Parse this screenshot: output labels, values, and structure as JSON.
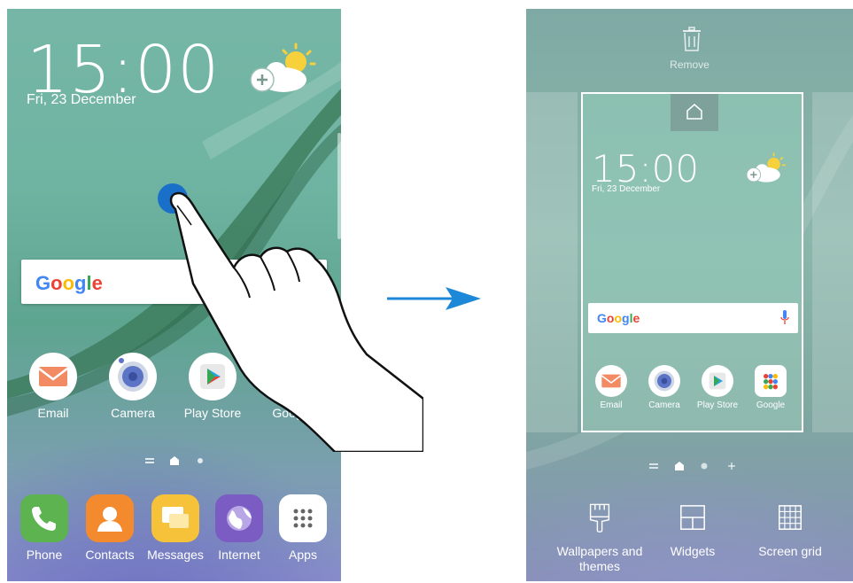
{
  "left_screen": {
    "clock": "15:00",
    "date": "Fri, 23 December",
    "search_logo": "Google",
    "apps": [
      {
        "label": "Email",
        "icon": "email-icon"
      },
      {
        "label": "Camera",
        "icon": "camera-icon"
      },
      {
        "label": "Play Store",
        "icon": "play-store-icon"
      },
      {
        "label": "Google",
        "icon": "google-apps-icon"
      }
    ],
    "dock": [
      {
        "label": "Phone",
        "icon": "phone-icon"
      },
      {
        "label": "Contacts",
        "icon": "contacts-icon"
      },
      {
        "label": "Messages",
        "icon": "messages-icon"
      },
      {
        "label": "Internet",
        "icon": "internet-icon"
      },
      {
        "label": "Apps",
        "icon": "apps-grid-icon"
      }
    ]
  },
  "right_screen": {
    "remove_label": "Remove",
    "preview": {
      "clock": "15:00",
      "date": "Fri, 23 December",
      "search_logo": "Google",
      "apps": [
        {
          "label": "Email"
        },
        {
          "label": "Camera"
        },
        {
          "label": "Play Store"
        },
        {
          "label": "Google"
        }
      ]
    },
    "options": [
      {
        "label_line1": "Wallpapers and",
        "label_line2": "themes",
        "icon": "paintbrush-icon"
      },
      {
        "label_line1": "Widgets",
        "label_line2": "",
        "icon": "widgets-icon"
      },
      {
        "label_line1": "Screen grid",
        "label_line2": "",
        "icon": "grid-icon"
      }
    ]
  },
  "colors": {
    "arrow": "#1e88d8",
    "touch_dot": "#1a6fc9"
  }
}
